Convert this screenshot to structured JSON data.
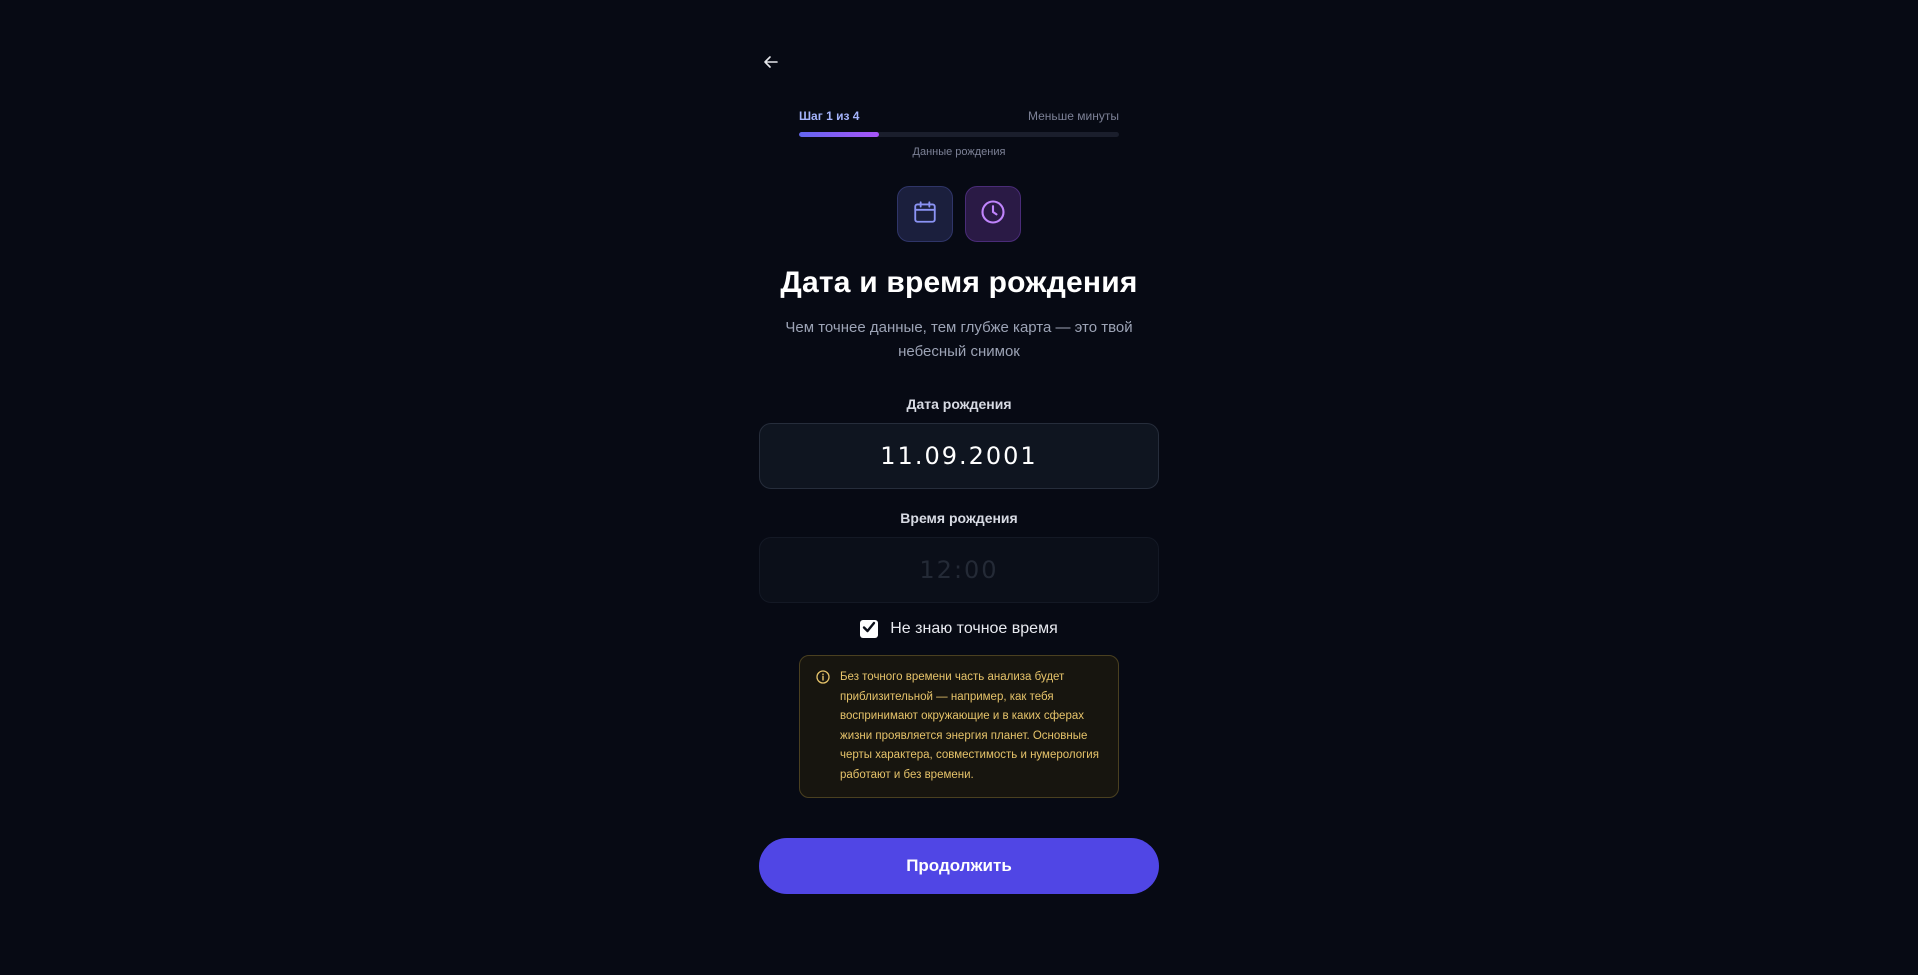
{
  "header": {
    "back_icon": "arrow-left-icon"
  },
  "progress": {
    "step_label": "Шаг 1 из 4",
    "eta_label": "Меньше минуты",
    "fraction": 0.25,
    "section_label": "Данные рождения",
    "accent_color": "#6366f1",
    "accent_color_end": "#a855f7"
  },
  "icons": [
    "calendar-icon",
    "clock-icon"
  ],
  "main": {
    "title": "Дата и время рождения",
    "subtitle": "Чем точнее данные, тем глубже карта — это твой небесный снимок"
  },
  "form": {
    "date_label": "Дата рождения",
    "date_value": "11.09.2001",
    "time_label": "Время рождения",
    "time_placeholder": "12:00",
    "time_disabled": true,
    "unknown_time_label": "Не знаю точное время",
    "unknown_time_checked": true
  },
  "notice": {
    "icon": "info-icon",
    "text": "Без точного времени часть анализа будет приблизительной — например, как тебя воспринимают окружающие и в каких сферах жизни проявляется энергия планет. Основные черты характера, совместимость и нумерология работают и без времени.",
    "color": "#e6c36a"
  },
  "actions": {
    "continue_label": "Продолжить",
    "button_color": "#5046e5"
  }
}
